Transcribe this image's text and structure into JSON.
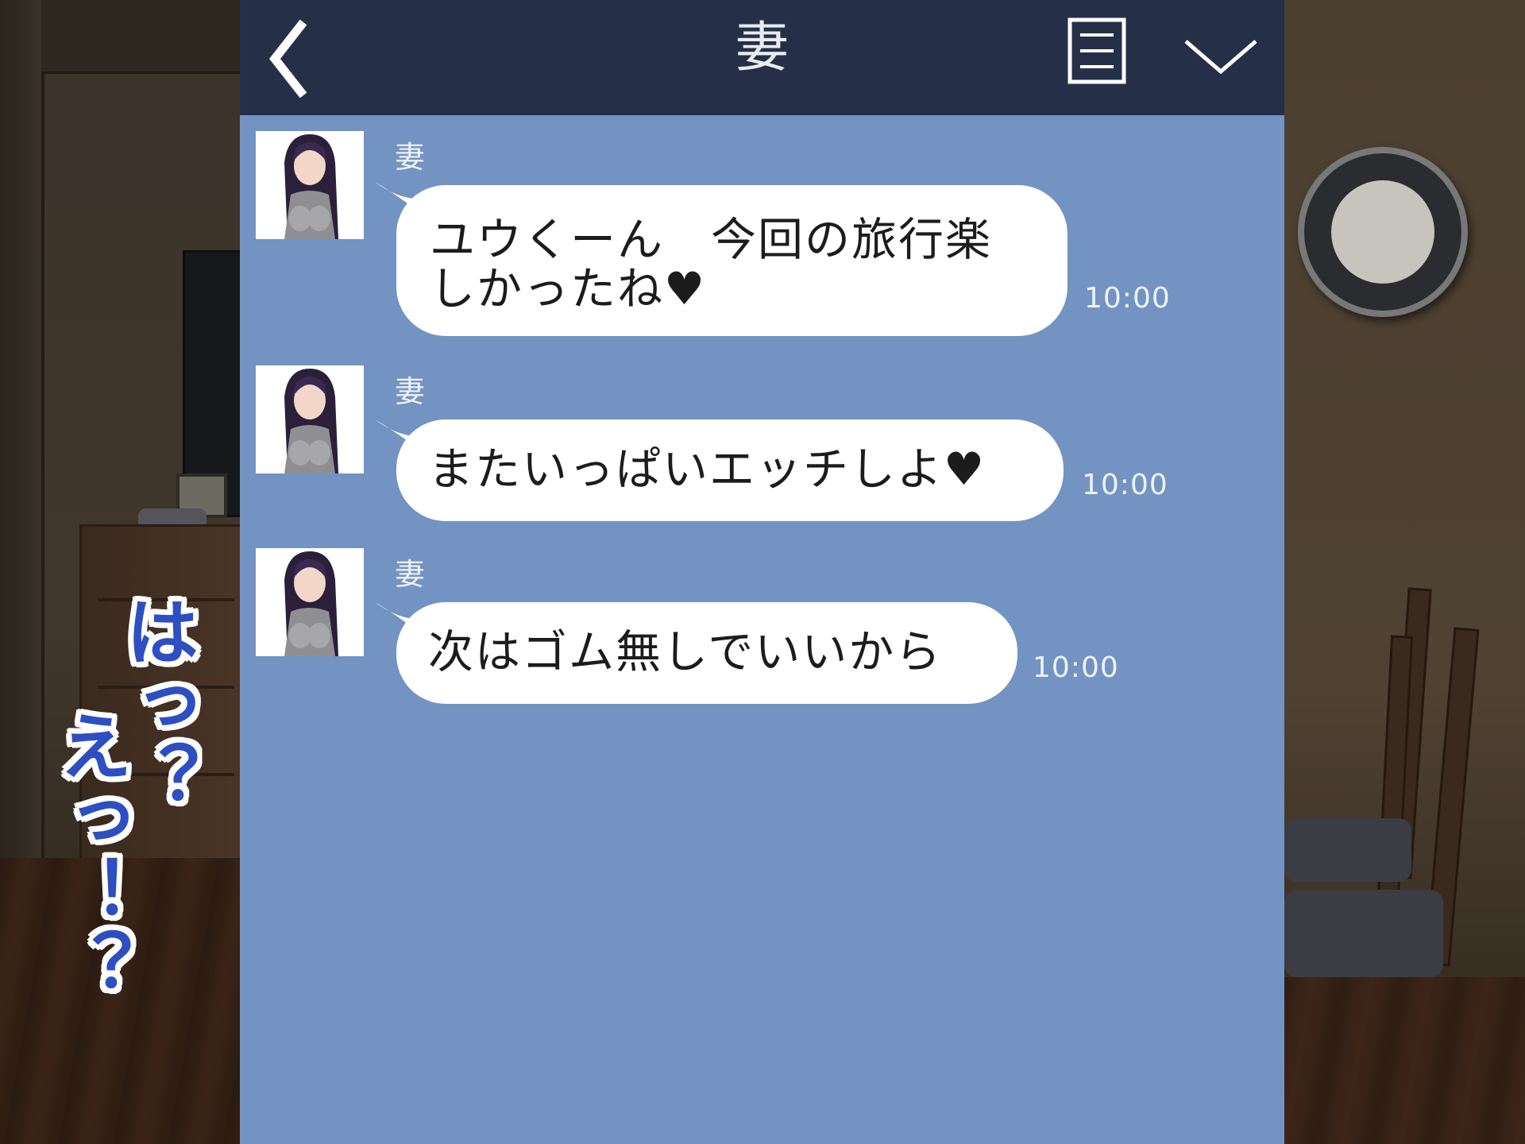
{
  "header": {
    "title": "妻",
    "back_icon": "chevron-left-icon",
    "menu_icon": "note-menu-icon",
    "collapse_icon": "chevron-down-icon"
  },
  "messages": [
    {
      "sender": "妻",
      "line1": "ユウくーん　今回の旅行楽",
      "line2": "しかったね",
      "heart": "♥",
      "time": "10:00"
    },
    {
      "sender": "妻",
      "line1": "またいっぱいエッチしよ",
      "heart": "♥",
      "time": "10:00"
    },
    {
      "sender": "妻",
      "line1": "次はゴム無しでいいから",
      "time": "10:00"
    }
  ],
  "reactions": {
    "first": "はっ？",
    "second": "えっ！？"
  },
  "colors": {
    "header_bg": "#253048",
    "chat_bg": "#7393c2",
    "bubble_bg": "#ffffff",
    "reaction_text": "#2d4fc2"
  }
}
